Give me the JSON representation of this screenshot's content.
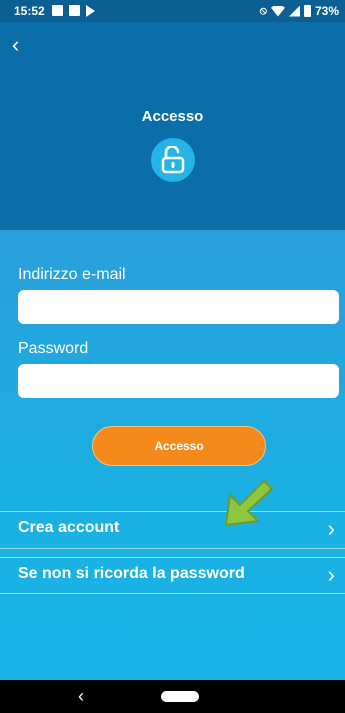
{
  "status_bar": {
    "time": "15:52",
    "battery": "73%"
  },
  "header": {
    "title": "Accesso"
  },
  "form": {
    "email_label": "Indirizzo e-mail",
    "email_value": "",
    "password_label": "Password",
    "password_value": "",
    "submit_label": "Accesso"
  },
  "menu": {
    "items": [
      {
        "label": "Crea account"
      },
      {
        "label": "Se non si ricorda la password"
      }
    ]
  },
  "colors": {
    "header": "#0b6ea8",
    "accent_button": "#f48a1b",
    "lock_badge": "#24b4e8",
    "hint_arrow": "#8dc63f"
  },
  "icons": [
    "back-chevron-icon",
    "unlock-icon",
    "chevron-right-icon",
    "hint-arrow-icon",
    "wifi-icon",
    "signal-icon",
    "battery-icon"
  ]
}
